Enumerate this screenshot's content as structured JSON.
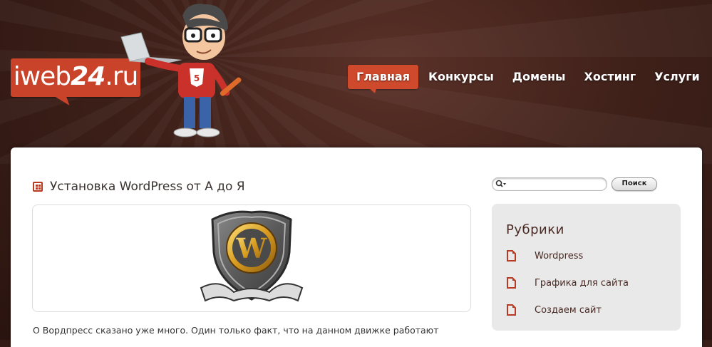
{
  "logo": {
    "text_main": "iweb",
    "text_bold": "24",
    "text_suffix": ".ru"
  },
  "nav": {
    "items": [
      {
        "label": "Главная",
        "active": true
      },
      {
        "label": "Конкурсы"
      },
      {
        "label": "Домены"
      },
      {
        "label": "Хостинг"
      },
      {
        "label": "Услуги"
      }
    ]
  },
  "post": {
    "title": "Установка WordPress от А до Я",
    "excerpt": "О Вордпресс сказано уже много. Один только факт, что на данном движке работают"
  },
  "search": {
    "placeholder": "",
    "button_label": "Поиск"
  },
  "sidebar": {
    "widget_title": "Рубрики",
    "categories": [
      {
        "label": "Wordpress"
      },
      {
        "label": "Графика для сайта"
      },
      {
        "label": "Создаем сайт"
      }
    ]
  },
  "colors": {
    "accent": "#cf4a2c",
    "background": "#3e2019",
    "widget_bg": "#e9e9e9"
  }
}
